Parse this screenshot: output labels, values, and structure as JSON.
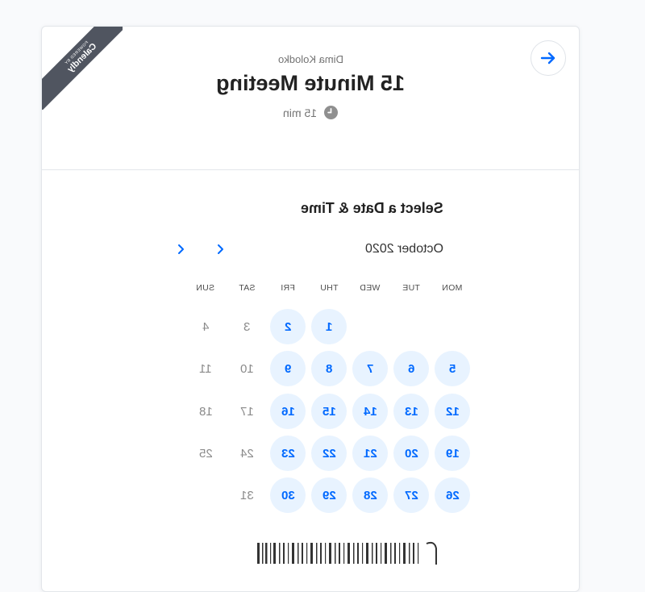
{
  "ribbon": {
    "small": "POWERED BY",
    "brand": "Calendly"
  },
  "event": {
    "owner": "Dima Kolodko",
    "title": "15 Minute Meeting",
    "duration": "15 min"
  },
  "calendar": {
    "heading": "Select a Date & Time",
    "month": "October 2020",
    "weekdays": [
      "MON",
      "TUE",
      "WED",
      "THU",
      "FRI",
      "SAT",
      "SUN"
    ],
    "weeks": [
      [
        null,
        null,
        null,
        {
          "d": "1",
          "a": true
        },
        {
          "d": "2",
          "a": true
        },
        {
          "d": "3",
          "a": false
        },
        {
          "d": "4",
          "a": false
        }
      ],
      [
        {
          "d": "5",
          "a": true
        },
        {
          "d": "6",
          "a": true
        },
        {
          "d": "7",
          "a": true
        },
        {
          "d": "8",
          "a": true
        },
        {
          "d": "9",
          "a": true
        },
        {
          "d": "10",
          "a": false
        },
        {
          "d": "11",
          "a": false
        }
      ],
      [
        {
          "d": "12",
          "a": true
        },
        {
          "d": "13",
          "a": true
        },
        {
          "d": "14",
          "a": true
        },
        {
          "d": "15",
          "a": true
        },
        {
          "d": "16",
          "a": true
        },
        {
          "d": "17",
          "a": false
        },
        {
          "d": "18",
          "a": false
        }
      ],
      [
        {
          "d": "19",
          "a": true
        },
        {
          "d": "20",
          "a": true
        },
        {
          "d": "21",
          "a": true
        },
        {
          "d": "22",
          "a": true
        },
        {
          "d": "23",
          "a": true
        },
        {
          "d": "24",
          "a": false
        },
        {
          "d": "25",
          "a": false
        }
      ],
      [
        {
          "d": "26",
          "a": true
        },
        {
          "d": "27",
          "a": true
        },
        {
          "d": "28",
          "a": true
        },
        {
          "d": "29",
          "a": true
        },
        {
          "d": "30",
          "a": true
        },
        {
          "d": "31",
          "a": false
        },
        null
      ]
    ]
  },
  "colors": {
    "accent": "#0069ff",
    "available_bg": "#e8f3ff",
    "ribbon": "#505560"
  },
  "icons": {
    "next": "arrow-right-icon",
    "clock": "clock-icon",
    "prev_month": "chevron-left-icon",
    "next_month": "chevron-right-icon"
  }
}
